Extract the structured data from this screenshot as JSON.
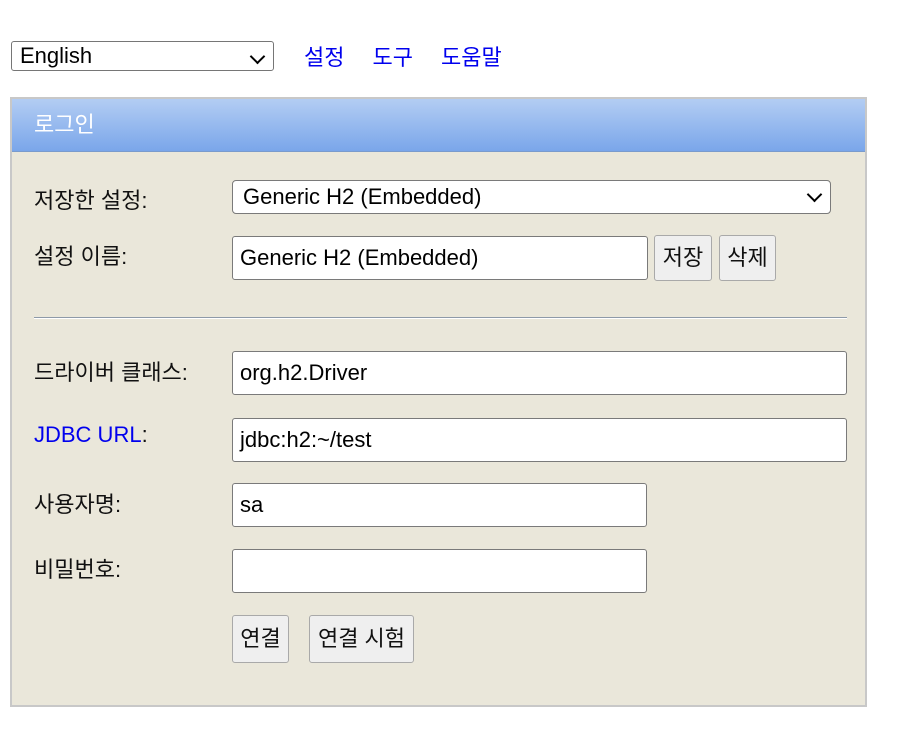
{
  "topbar": {
    "language": "English",
    "links": [
      "설정",
      "도구",
      "도움말"
    ]
  },
  "login": {
    "title": "로그인",
    "saved_settings_label": "저장한 설정:",
    "saved_settings_value": "Generic H2 (Embedded)",
    "setting_name_label": "설정 이름:",
    "setting_name_value": "Generic H2 (Embedded)",
    "save_button": "저장",
    "delete_button": "삭제",
    "driver_class_label": "드라이버 클래스:",
    "driver_class_value": "org.h2.Driver",
    "jdbc_url_label": "JDBC URL",
    "jdbc_url_colon": ":",
    "jdbc_url_value": "jdbc:h2:~/test",
    "username_label": "사용자명:",
    "username_value": "sa",
    "password_label": "비밀번호:",
    "password_value": "",
    "connect_button": "연결",
    "test_connection_button": "연결 시험"
  },
  "colors": {
    "link": "#0000ee",
    "panel_bg": "#eae7da",
    "header_top": "#b3cdf3",
    "header_bottom": "#7aa6ea"
  },
  "icons": {
    "dropdown": "chevron-down-icon"
  }
}
